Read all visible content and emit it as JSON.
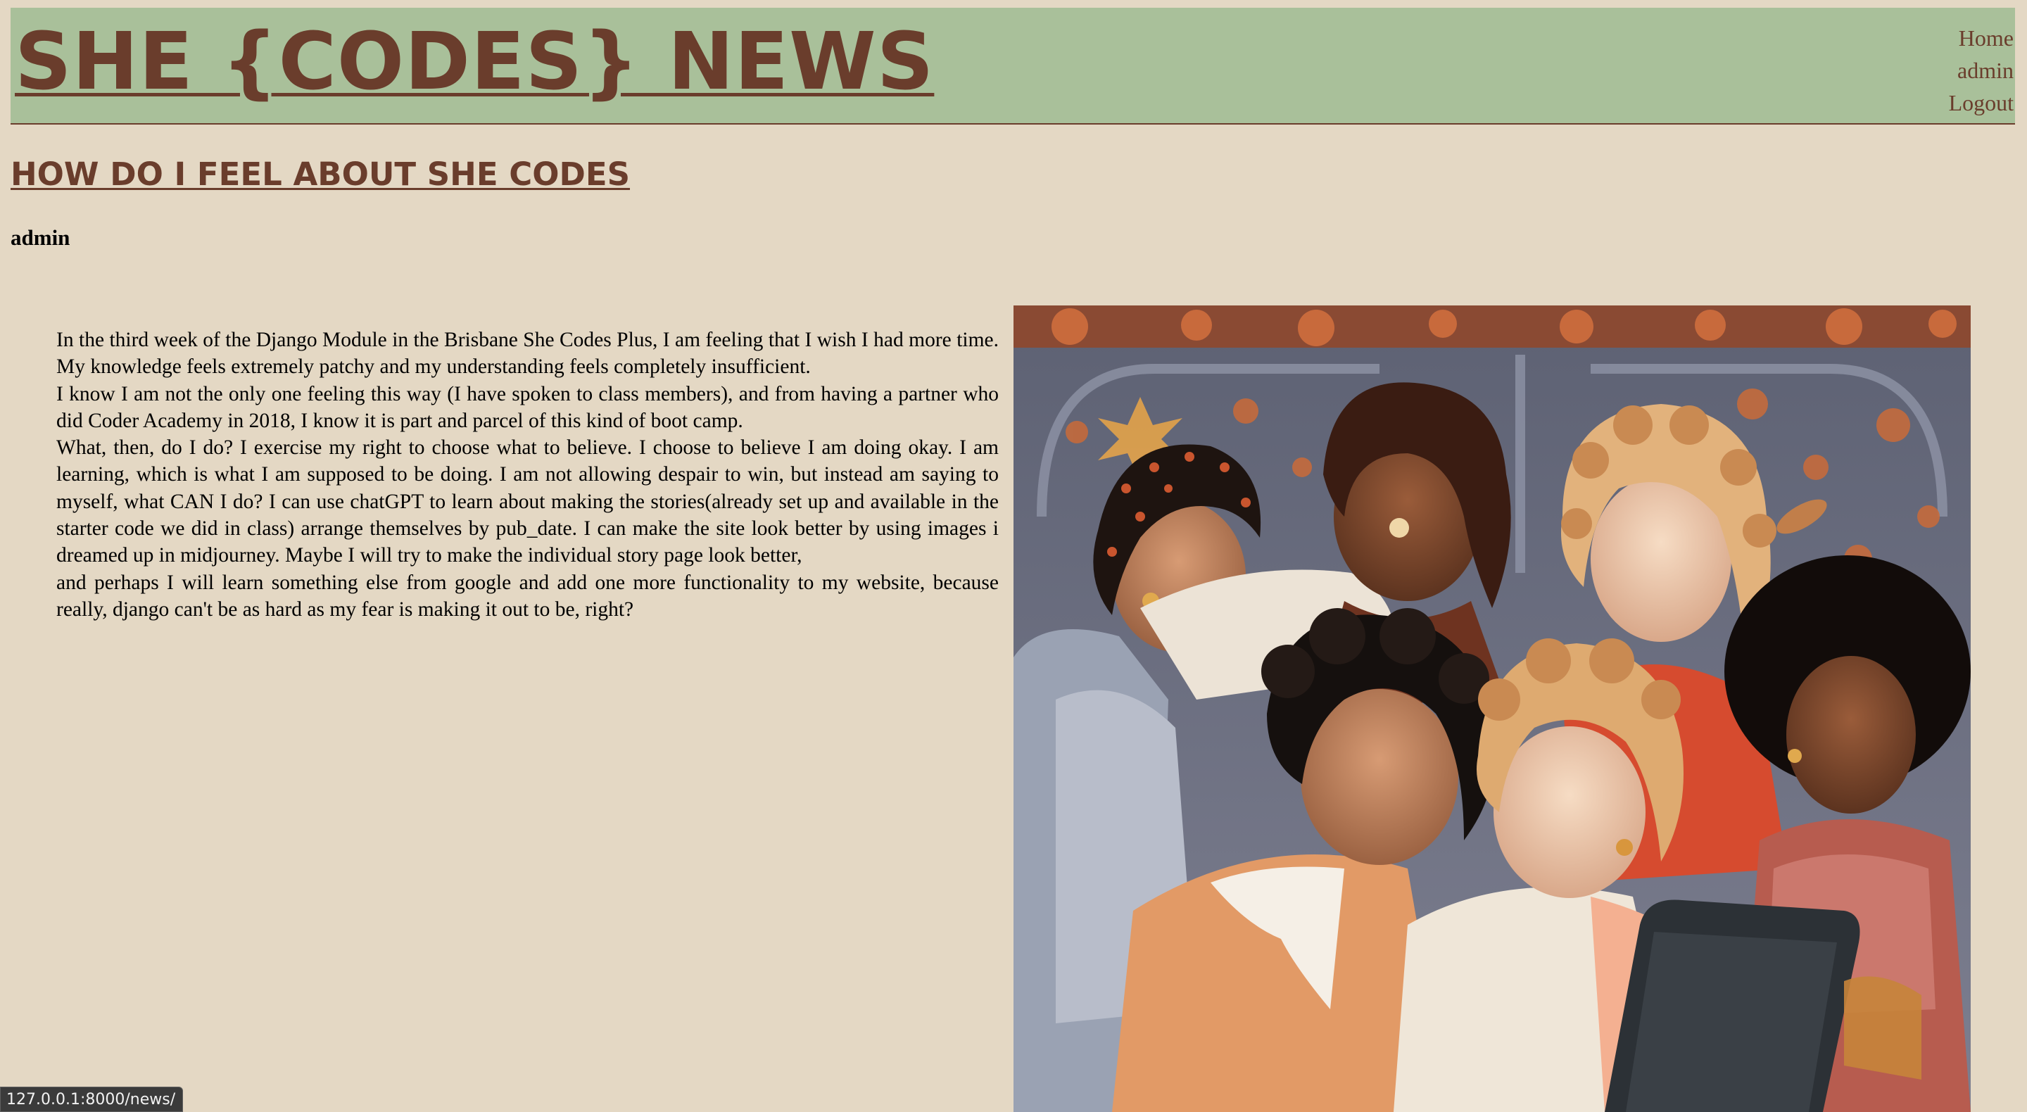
{
  "header": {
    "site_title": "SHE {CODES} NEWS",
    "nav": [
      {
        "label": "Home"
      },
      {
        "label": "admin"
      },
      {
        "label": "Logout"
      }
    ]
  },
  "story": {
    "title": "HOW DO I FEEL ABOUT SHE CODES",
    "author": "admin",
    "paragraphs": [
      "In the third week of the Django Module in the Brisbane She Codes Plus, I am feeling that I wish I had more time. My knowledge feels extremely patchy and my understanding feels completely insufficient.",
      "I know I am not the only one feeling this way (I have spoken to class members), and from having a partner who did Coder Academy in 2018, I know it is part and parcel of this kind of boot camp.",
      "What, then, do I do? I exercise my right to choose what to believe. I choose to believe I am doing okay. I am learning, which is what I am supposed to be doing. I am not allowing despair to win, but instead am saying to myself, what CAN I do? I can use chatGPT to learn about making the stories(already set up and available in the starter code we did in class) arrange themselves by pub_date. I can make the site look better by using images i dreamed up in midjourney. Maybe I will try to make the individual story page look better,",
      "and perhaps I will learn something else from google and add one more functionality to my website, because really, django can't be as hard as my fear is making it out to be, right?"
    ]
  },
  "status_bar": {
    "url": "127.0.0.1:8000/news/"
  },
  "colors": {
    "background": "#e4d8c4",
    "header_bg": "#a9c09a",
    "brand_brown": "#6a3d2c"
  }
}
